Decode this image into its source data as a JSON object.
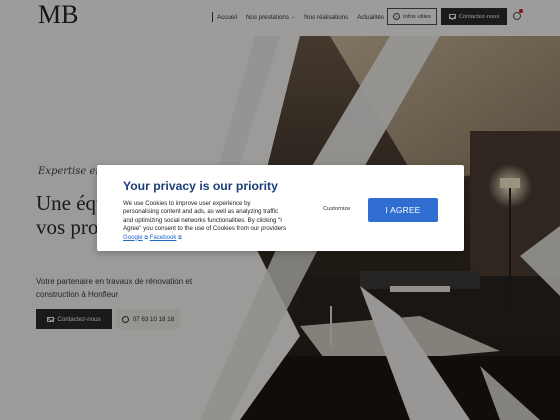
{
  "header": {
    "logo": "MB",
    "nav": [
      {
        "label": "Accueil"
      },
      {
        "label": "Nos prestations",
        "caret": "⌄"
      },
      {
        "label": "Nos réalisations"
      },
      {
        "label": "Actualités"
      }
    ],
    "info_button": "Infos utiles",
    "contact_button": "Contactez-nous"
  },
  "hero": {
    "tagline": "Expertise en",
    "title": "Une équipe de professionnels pour vos projets clés en main",
    "subtitle": "Votre partenaire en travaux de rénovation et construction à Honfleur",
    "contact_button": "Contactez-nous",
    "phone": "07 63 10 18 18"
  },
  "cookie_modal": {
    "title": "Your privacy is our priority",
    "text": "We use Cookies to improve user experience by personalising content and ads, as well as analyzing traffic and optimizing social networks functionalities. By clicking \"I Agree\" you consent to the use of Cookies from our providers",
    "link_google": "Google",
    "link_facebook": "Facebook",
    "customize": "Customize",
    "agree": "I AGREE"
  },
  "colors": {
    "modal_title": "#1c3f78",
    "agree_button": "#2f6ed0",
    "dark_button": "#2d2b28",
    "notification_dot": "#c8202a"
  },
  "icons": [
    "info-icon",
    "mail-icon",
    "globe-icon",
    "phone-icon",
    "external-link-icon"
  ]
}
